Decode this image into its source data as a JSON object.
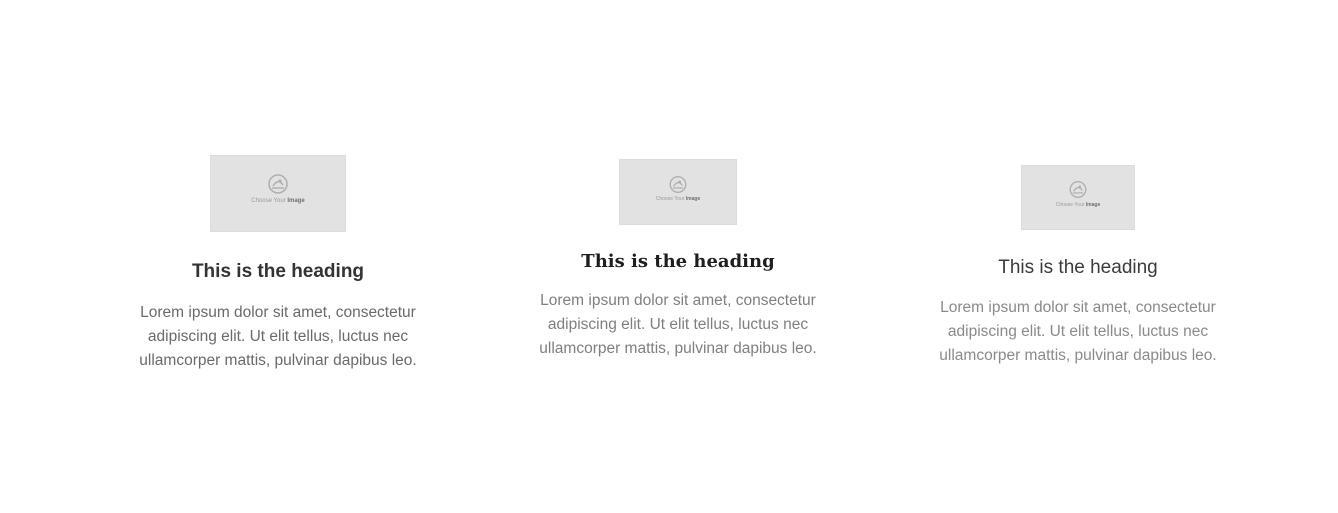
{
  "boxes": [
    {
      "image": {
        "caption_prefix": "Choose Your",
        "caption_strong": "Image",
        "icon": "image-placeholder-icon"
      },
      "heading": "This is the heading",
      "text": "Lorem ipsum dolor sit amet, consectetur adipiscing elit. Ut elit tellus, luctus nec ullamcorper mattis, pulvinar dapibus leo."
    },
    {
      "image": {
        "caption_prefix": "Choose Your",
        "caption_strong": "Image",
        "icon": "image-placeholder-icon"
      },
      "heading": "This is the heading",
      "text": "Lorem ipsum dolor sit amet, consectetur adipiscing elit. Ut elit tellus, luctus nec ullamcorper mattis, pulvinar dapibus leo."
    },
    {
      "image": {
        "caption_prefix": "Choose Your",
        "caption_strong": "Image",
        "icon": "image-placeholder-icon"
      },
      "heading": "This is the heading",
      "text": "Lorem ipsum dolor sit amet, consectetur adipiscing elit. Ut elit tellus, luctus nec ullamcorper mattis, pulvinar dapibus leo."
    }
  ],
  "colors": {
    "placeholder_bg": "#e2e2e2",
    "heading": "#333333",
    "text": "#7a7a7a"
  }
}
